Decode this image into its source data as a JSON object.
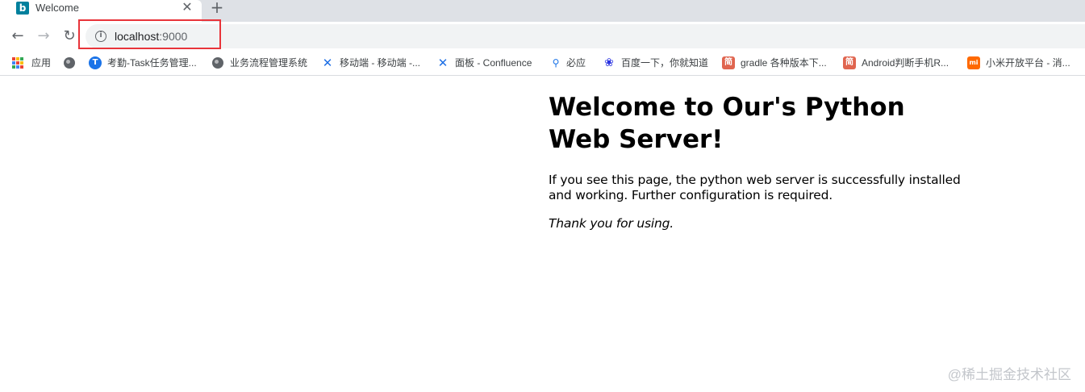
{
  "tab": {
    "title": "Welcome",
    "favicon_glyph": "b",
    "close_glyph": "✕",
    "new_tab_glyph": "+"
  },
  "toolbar": {
    "back_glyph": "←",
    "forward_glyph": "→",
    "reload_glyph": "↻",
    "info_glyph": "i",
    "url_host": "localhost",
    "url_port": ":9000",
    "highlight_color": "#e8343a"
  },
  "bookmarks": [
    {
      "label": "应用",
      "icon": "apps-grid-icon"
    },
    {
      "label": "",
      "icon": "globe-icon"
    },
    {
      "label": "考勤-Task任务管理...",
      "icon": "task-icon",
      "glyph": "T",
      "color": "#1a73e8"
    },
    {
      "label": "业务流程管理系统",
      "icon": "globe-icon"
    },
    {
      "label": "移动端 - 移动端 -...",
      "icon": "confluence-icon",
      "glyph": "✕",
      "color": "#1e6fe5"
    },
    {
      "label": "面板 - Confluence",
      "icon": "confluence-icon",
      "glyph": "✕",
      "color": "#1e6fe5"
    },
    {
      "label": "必应",
      "icon": "search-icon",
      "glyph": "⚲",
      "color": "#1a73e8"
    },
    {
      "label": "百度一下，你就知道",
      "icon": "baidu-paw-icon",
      "glyph": "❀",
      "color": "#2932e1"
    },
    {
      "label": "gradle 各种版本下...",
      "icon": "jianshu-icon",
      "glyph": "简",
      "color": "#e0654f"
    },
    {
      "label": "Android判断手机R...",
      "icon": "jianshu-icon",
      "glyph": "简",
      "color": "#e0654f"
    },
    {
      "label": "小米开放平台 - 消...",
      "icon": "mi-icon",
      "glyph": "mi",
      "color": "#ff6900"
    }
  ],
  "page": {
    "heading": "Welcome to Our's Python Web Server!",
    "paragraph": "If you see this page, the python web server is successfully installed and working. Further configuration is required.",
    "thanks": "Thank you for using."
  },
  "watermark": "@稀土掘金技术社区",
  "colors": {
    "tab_strip": "#dee1e6",
    "omnibox": "#f1f3f4",
    "favicon": "#00809d"
  }
}
